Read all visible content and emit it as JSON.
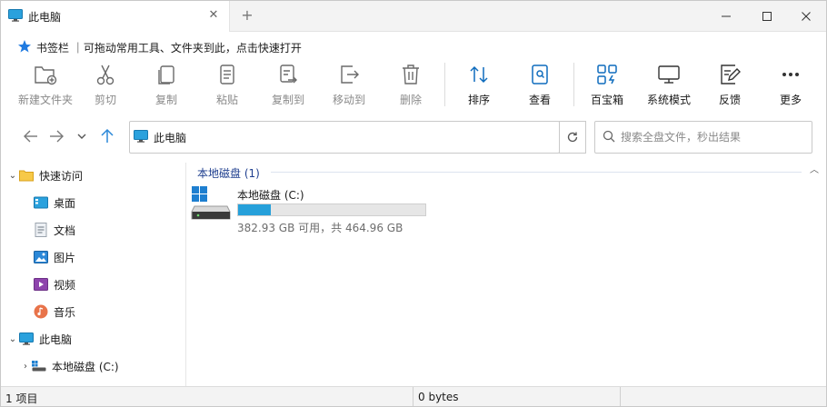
{
  "tab": {
    "title": "此电脑",
    "close_icon": "close-icon"
  },
  "window_controls": {
    "minimize": "minimize-icon",
    "maximize": "maximize-icon",
    "close": "close-icon"
  },
  "bookmarks": {
    "label": "书签栏 ｜可拖动常用工具、文件夹到此，点击快速打开"
  },
  "ribbon": {
    "items": [
      {
        "label": "新建文件夹",
        "icon": "new-folder-icon",
        "enabled": false
      },
      {
        "label": "剪切",
        "icon": "scissors-icon",
        "enabled": false
      },
      {
        "label": "复制",
        "icon": "copy-icon",
        "enabled": false
      },
      {
        "label": "粘贴",
        "icon": "paste-icon",
        "enabled": false
      },
      {
        "label": "复制到",
        "icon": "copy-to-icon",
        "enabled": false
      },
      {
        "label": "移动到",
        "icon": "move-to-icon",
        "enabled": false
      },
      {
        "label": "删除",
        "icon": "delete-icon",
        "enabled": false
      },
      {
        "label": "排序",
        "icon": "sort-icon",
        "enabled": true
      },
      {
        "label": "查看",
        "icon": "view-icon",
        "enabled": true
      },
      {
        "label": "百宝箱",
        "icon": "toolbox-icon",
        "enabled": true
      },
      {
        "label": "系统模式",
        "icon": "system-mode-icon",
        "enabled": true
      },
      {
        "label": "反馈",
        "icon": "feedback-icon",
        "enabled": true
      },
      {
        "label": "更多",
        "icon": "more-icon",
        "enabled": true
      }
    ]
  },
  "address": {
    "path": "此电脑"
  },
  "search": {
    "placeholder": "搜索全盘文件，秒出结果"
  },
  "sidebar": {
    "quick_access": "快速访问",
    "items": [
      {
        "label": "桌面",
        "icon": "desktop-icon"
      },
      {
        "label": "文档",
        "icon": "document-icon"
      },
      {
        "label": "图片",
        "icon": "pictures-icon"
      },
      {
        "label": "视频",
        "icon": "video-icon"
      },
      {
        "label": "音乐",
        "icon": "music-icon"
      }
    ],
    "this_pc": "此电脑",
    "drive": "本地磁盘 (C:)"
  },
  "main": {
    "group_title": "本地磁盘 (1)",
    "drive_name": "本地磁盘 (C:)",
    "drive_info": "382.93 GB 可用，共 464.96 GB",
    "used_fraction": 0.176
  },
  "status": {
    "items": "1 项目",
    "size": "0 bytes"
  },
  "colors": {
    "accent": "#26a0da",
    "group_header": "#1f3f8f",
    "star": "#1f7ae0"
  }
}
